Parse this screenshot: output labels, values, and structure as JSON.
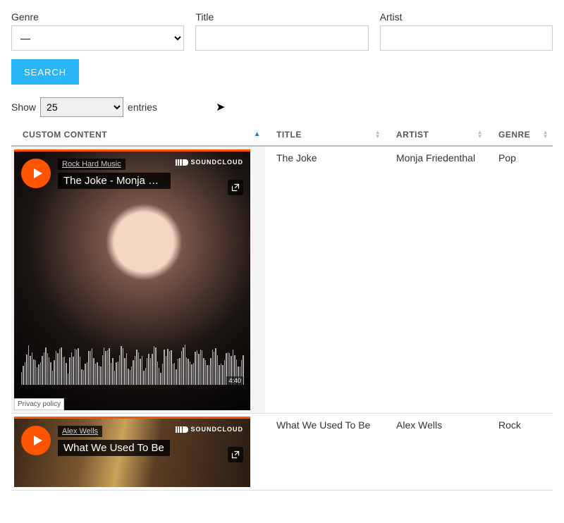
{
  "filters": {
    "genre_label": "Genre",
    "genre_value": "—",
    "title_label": "Title",
    "title_value": "",
    "artist_label": "Artist",
    "artist_value": ""
  },
  "search_button": "SEARCH",
  "length": {
    "show_label": "Show",
    "entries_label": "entries",
    "value": "25"
  },
  "columns": {
    "custom_content": "CUSTOM CONTENT",
    "title": "TITLE",
    "artist": "ARTIST",
    "genre": "GENRE"
  },
  "soundcloud_text": "SOUNDCLOUD",
  "privacy_text": "Privacy policy",
  "rows": [
    {
      "embed_channel": "Rock Hard Music",
      "embed_title": "The Joke - Monja Fried...",
      "duration": "4:40",
      "title": "The Joke",
      "artist": "Monja Friedenthal",
      "genre": "Pop"
    },
    {
      "embed_channel": "Alex Wells",
      "embed_title": "What We Used To Be",
      "duration": "",
      "title": "What We Used To Be",
      "artist": "Alex Wells",
      "genre": "Rock"
    }
  ]
}
